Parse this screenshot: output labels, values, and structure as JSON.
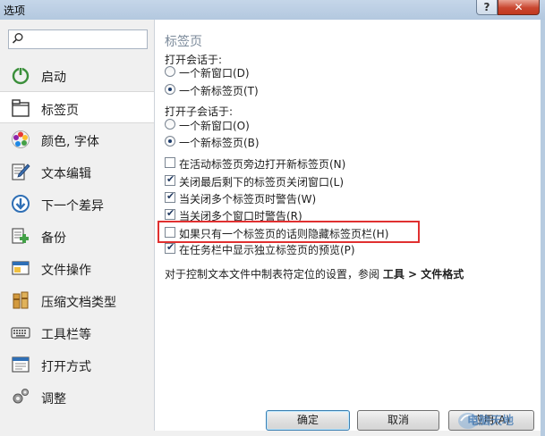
{
  "window": {
    "title": "选项",
    "help_label": "?",
    "close_label": "✕"
  },
  "sidebar": {
    "search_placeholder": "",
    "items": [
      {
        "label": "启动",
        "icon": "power-icon"
      },
      {
        "label": "标签页",
        "icon": "tab-page-icon"
      },
      {
        "label": "颜色, 字体",
        "icon": "color-palette-icon"
      },
      {
        "label": "文本编辑",
        "icon": "text-edit-icon"
      },
      {
        "label": "下一个差异",
        "icon": "next-diff-icon"
      },
      {
        "label": "备份",
        "icon": "backup-icon"
      },
      {
        "label": "文件操作",
        "icon": "file-operation-icon"
      },
      {
        "label": "压缩文档类型",
        "icon": "archive-icon"
      },
      {
        "label": "工具栏等",
        "icon": "keyboard-icon"
      },
      {
        "label": "打开方式",
        "icon": "open-with-icon"
      },
      {
        "label": "调整",
        "icon": "gears-icon"
      }
    ],
    "selected": "标签页"
  },
  "panel": {
    "title": "标签页",
    "open_in_label": "打开会话于:",
    "open_in_options": [
      {
        "label": "一个新窗口(D)",
        "selected": false
      },
      {
        "label": "一个新标签页(T)",
        "selected": true
      }
    ],
    "open_child_label": "打开子会话于:",
    "open_child_options": [
      {
        "label": "一个新窗口(O)",
        "selected": false
      },
      {
        "label": "一个新标签页(B)",
        "selected": true
      }
    ],
    "checkboxes": [
      {
        "label": "在活动标签页旁边打开新标签页(N)",
        "checked": false
      },
      {
        "label": "关闭最后剩下的标签页关闭窗口(L)",
        "checked": true
      },
      {
        "label": "当关闭多个标签页时警告(W)",
        "checked": true
      },
      {
        "label": "当关闭多个窗口时警告(R)",
        "checked": true
      },
      {
        "label": "如果只有一个标签页的话则隐藏标签页栏(H)",
        "checked": false
      },
      {
        "label": "在任务栏中显示独立标签页的预览(P)",
        "checked": true
      }
    ],
    "hint_text": "对于控制文本文件中制表符定位的设置，参阅 ",
    "hint_path_1": "工具",
    "hint_sep": " > ",
    "hint_path_2": "文件格式"
  },
  "buttons": {
    "ok": "确定",
    "cancel": "取消",
    "apply": "应用(A)"
  },
  "watermark": "电脑天地"
}
